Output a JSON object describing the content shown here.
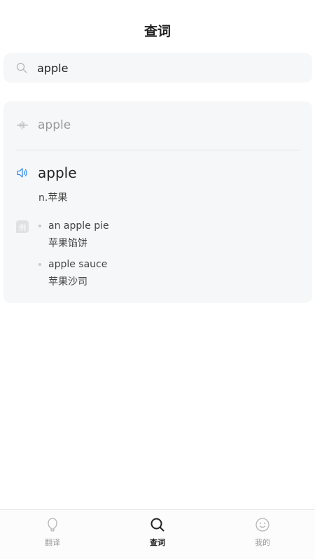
{
  "header": {
    "title": "查词"
  },
  "search": {
    "value": "apple",
    "icon": "search-icon"
  },
  "result": {
    "voice_input": "apple",
    "word": "apple",
    "definition": "n.苹果",
    "example_badge": "例",
    "examples": [
      {
        "en": "an apple pie",
        "zh": "苹果馅饼"
      },
      {
        "en": "apple sauce",
        "zh": "苹果沙司"
      }
    ]
  },
  "tabbar": {
    "items": [
      {
        "label": "翻译",
        "icon": "translate-icon",
        "active": false
      },
      {
        "label": "查词",
        "icon": "search-icon",
        "active": true
      },
      {
        "label": "我的",
        "icon": "smiley-icon",
        "active": false
      }
    ]
  },
  "colors": {
    "accent": "#3a8ee6",
    "card_bg": "#f6f7f8"
  }
}
